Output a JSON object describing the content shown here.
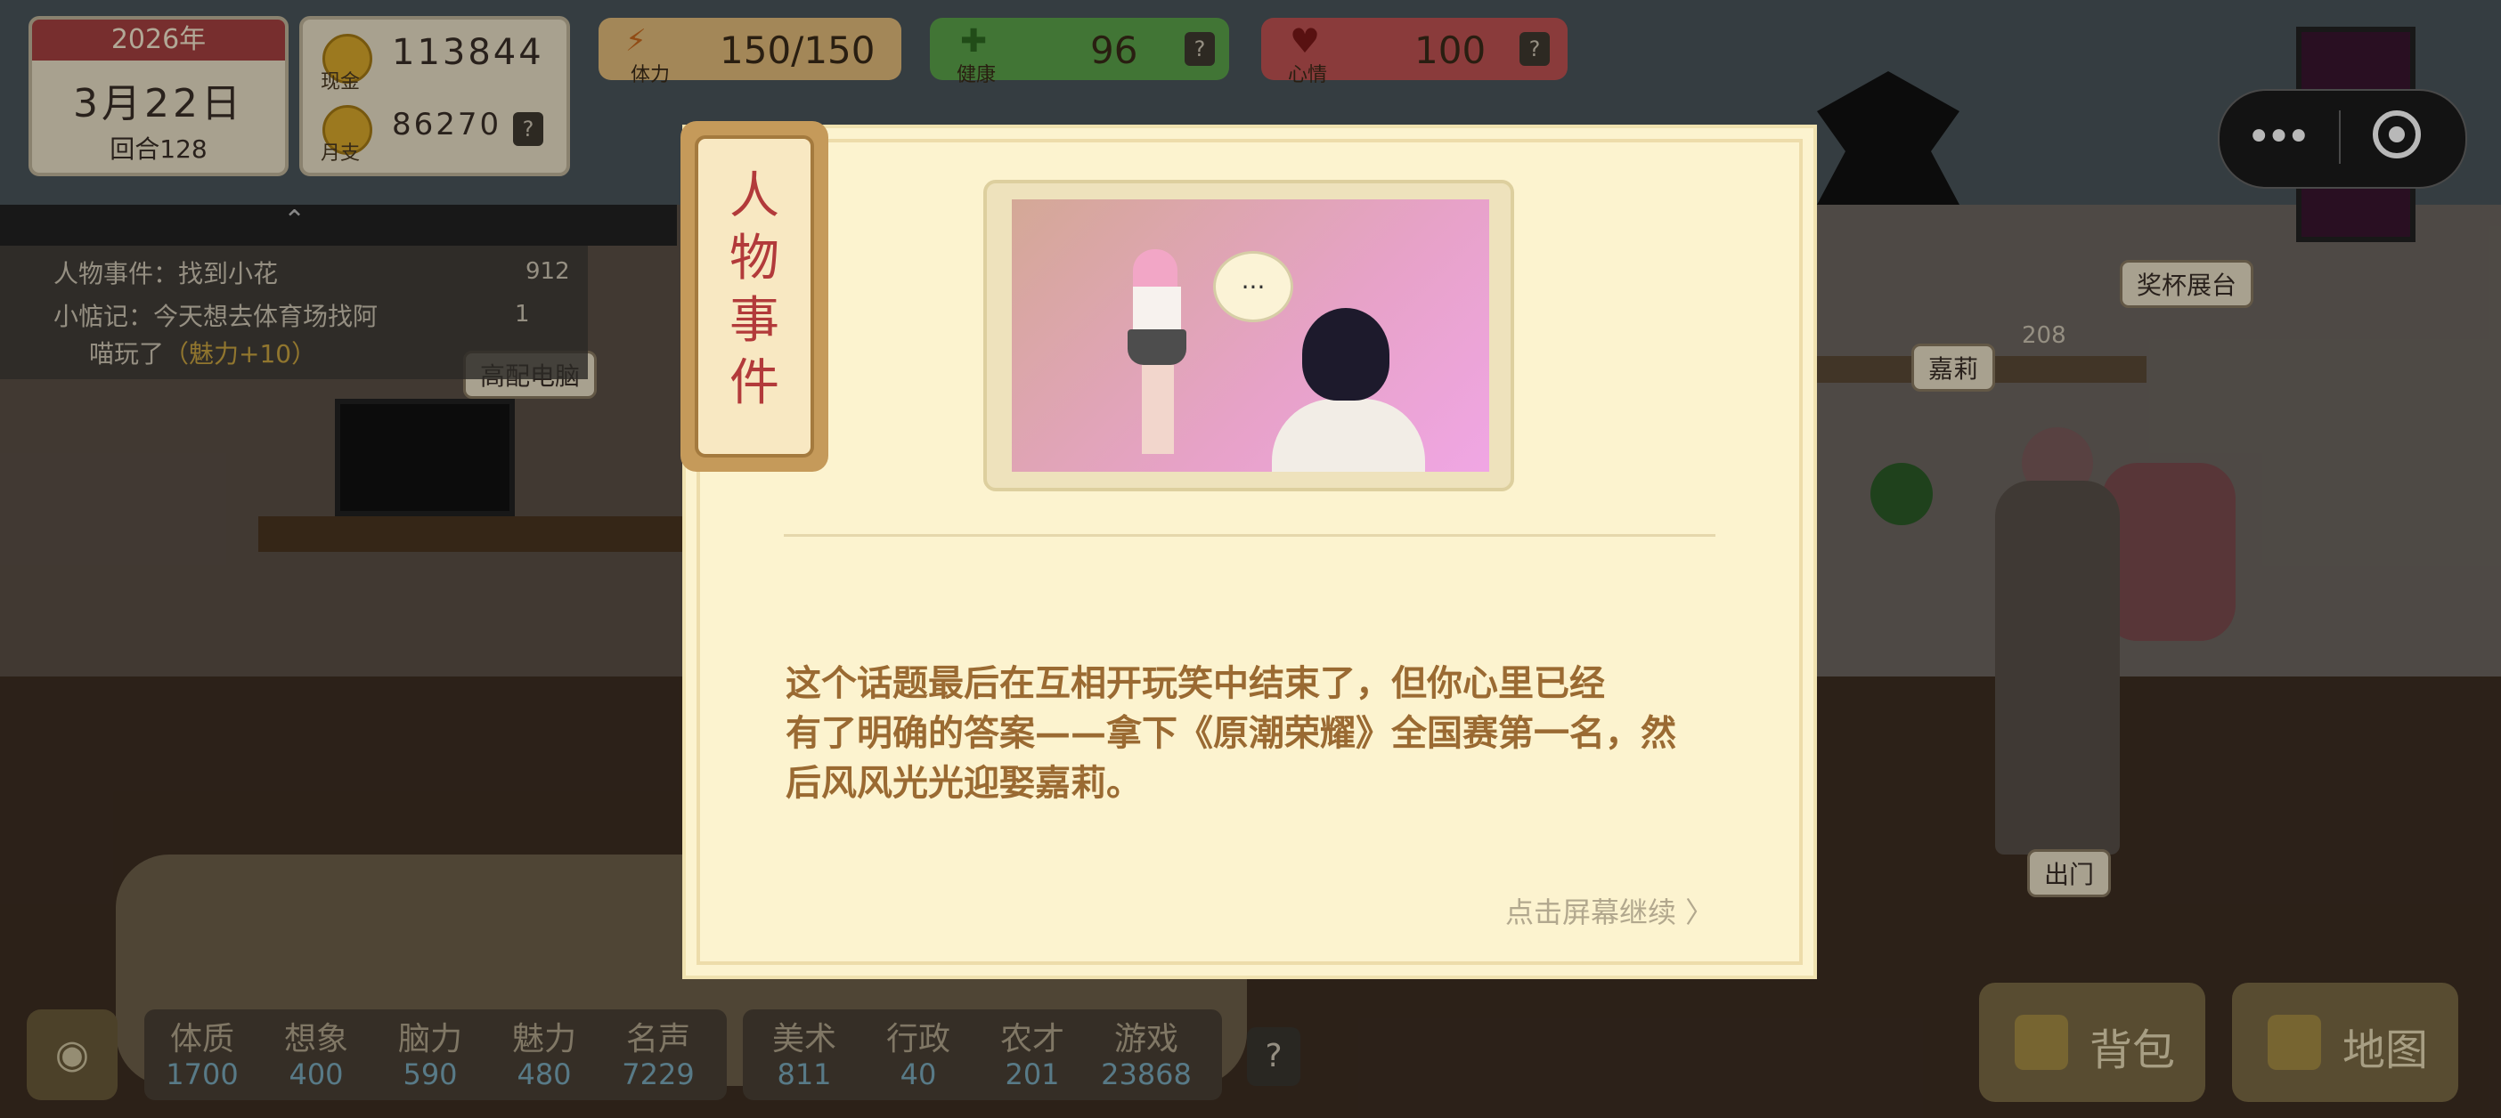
{
  "hud": {
    "year": "2026年",
    "date": "3月22日",
    "round": "回合128",
    "cash_label": "现金",
    "cash_value": "113844",
    "monthly_label": "月支",
    "monthly_value": "86270",
    "energy_label": "体力",
    "energy_value": "150/150",
    "health_label": "健康",
    "health_value": "96",
    "mood_label": "心情",
    "mood_value": "100",
    "help": "?"
  },
  "tasks": [
    {
      "text": "人物事件：找到小花",
      "count": "912"
    },
    {
      "text": "小惦记：今天想去体育场找阿喵玩了",
      "bonus": "（魅力+10）",
      "count": "1"
    }
  ],
  "tasks_wrap": {
    "line1": "小惦记：今天想去体育场找阿",
    "line2": "喵玩了"
  },
  "scene_labels": {
    "computer": "高配电脑",
    "trophy": "奖杯展台",
    "npc": "嘉莉",
    "exit": "出门",
    "trophy_count": "208"
  },
  "attributes": [
    {
      "name": "体质",
      "value": "1700"
    },
    {
      "name": "想象",
      "value": "400"
    },
    {
      "name": "脑力",
      "value": "590"
    },
    {
      "name": "魅力",
      "value": "480"
    },
    {
      "name": "名声",
      "value": "7229"
    }
  ],
  "skills": [
    {
      "name": "美术",
      "value": "811"
    },
    {
      "name": "行政",
      "value": "40"
    },
    {
      "name": "农才",
      "value": "201"
    },
    {
      "name": "游戏",
      "value": "23868"
    }
  ],
  "buttons": {
    "bag": "背包",
    "map": "地图"
  },
  "modal": {
    "tag_chars": [
      "人",
      "物",
      "事",
      "件"
    ],
    "bubble": "...",
    "story": "这个话题最后在互相开玩笑中结束了，但你心里已经有了明确的答案——拿下《原潮荣耀》全国赛第一名，然后风风光光迎娶嘉莉。",
    "story_lines": [
      "这个话题最后在互相开玩笑中结束了，但你心里已经",
      "有了明确的答案——拿下《原潮荣耀》全国赛第一名，然",
      "后风风光光迎娶嘉莉。"
    ],
    "continue": "点击屏幕继续 〉"
  },
  "colors": {
    "modal_bg": "#fcf3cf",
    "story_text": "#9a6a32",
    "tag_text": "#b23a3a",
    "energy": "#e2bb7a",
    "health": "#5aa24a",
    "mood": "#c05252"
  },
  "icons": [
    "coin-icon",
    "lightning-icon",
    "health-cross-icon",
    "heart-icon",
    "eye-icon",
    "bag-icon",
    "map-icon",
    "more-dots-icon",
    "target-icon",
    "chevron-up-icon"
  ]
}
